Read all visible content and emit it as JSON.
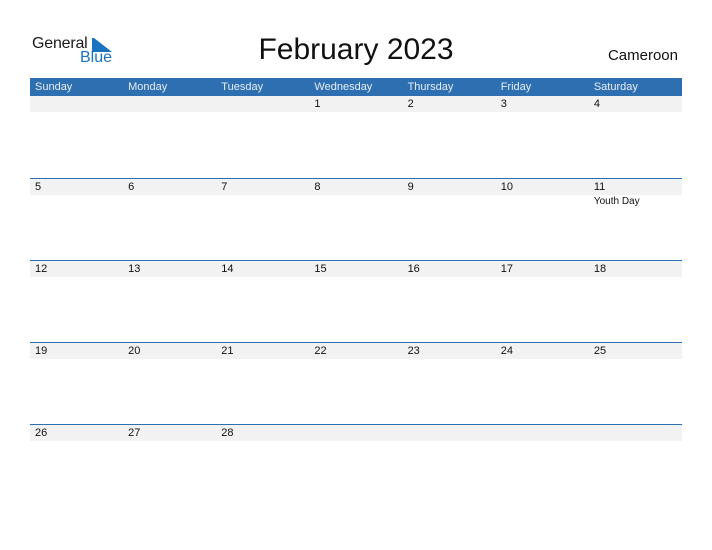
{
  "logo": {
    "line1": "General",
    "line2": "Blue"
  },
  "title": "February 2023",
  "country": "Cameroon",
  "colors": {
    "header_bg": "#2e6fb2",
    "accent": "#1a73c0",
    "date_strip": "#f2f2f2"
  },
  "weekdays": [
    "Sunday",
    "Monday",
    "Tuesday",
    "Wednesday",
    "Thursday",
    "Friday",
    "Saturday"
  ],
  "weeks": [
    {
      "days": [
        "",
        "",
        "",
        "1",
        "2",
        "3",
        "4"
      ],
      "events": [
        "",
        "",
        "",
        "",
        "",
        "",
        ""
      ]
    },
    {
      "days": [
        "5",
        "6",
        "7",
        "8",
        "9",
        "10",
        "11"
      ],
      "events": [
        "",
        "",
        "",
        "",
        "",
        "",
        "Youth Day"
      ]
    },
    {
      "days": [
        "12",
        "13",
        "14",
        "15",
        "16",
        "17",
        "18"
      ],
      "events": [
        "",
        "",
        "",
        "",
        "",
        "",
        ""
      ]
    },
    {
      "days": [
        "19",
        "20",
        "21",
        "22",
        "23",
        "24",
        "25"
      ],
      "events": [
        "",
        "",
        "",
        "",
        "",
        "",
        ""
      ]
    },
    {
      "days": [
        "26",
        "27",
        "28",
        "",
        "",
        "",
        ""
      ],
      "events": [
        "",
        "",
        "",
        "",
        "",
        "",
        ""
      ]
    }
  ]
}
